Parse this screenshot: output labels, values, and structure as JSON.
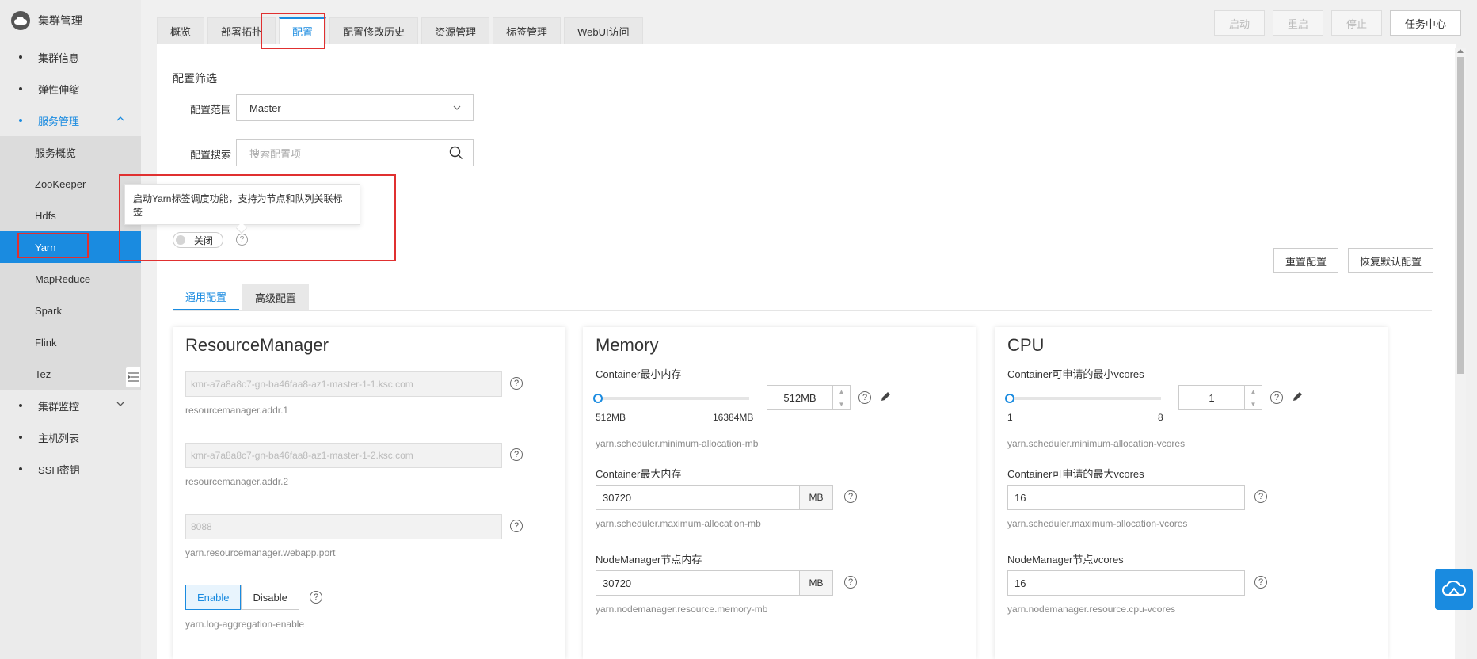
{
  "sidebar": {
    "title": "集群管理",
    "items": [
      {
        "label": "集群信息"
      },
      {
        "label": "弹性伸缩"
      },
      {
        "label": "服务管理"
      },
      {
        "label": "集群监控"
      },
      {
        "label": "主机列表"
      },
      {
        "label": "SSH密钥"
      }
    ],
    "sub_items": [
      {
        "label": "服务概览"
      },
      {
        "label": "ZooKeeper"
      },
      {
        "label": "Hdfs"
      },
      {
        "label": "Yarn"
      },
      {
        "label": "MapReduce"
      },
      {
        "label": "Spark"
      },
      {
        "label": "Flink"
      },
      {
        "label": "Tez"
      }
    ]
  },
  "tabs": [
    {
      "label": "概览"
    },
    {
      "label": "部署拓扑"
    },
    {
      "label": "配置"
    },
    {
      "label": "配置修改历史"
    },
    {
      "label": "资源管理"
    },
    {
      "label": "标签管理"
    },
    {
      "label": "WebUI访问"
    }
  ],
  "top_buttons": {
    "start": "启动",
    "restart": "重启",
    "stop": "停止",
    "task_center": "任务中心"
  },
  "filter": {
    "title": "配置筛选",
    "scope_label": "配置范围",
    "scope_value": "Master",
    "search_label": "配置搜索",
    "search_placeholder": "搜索配置项"
  },
  "tooltip": {
    "text": "启动Yarn标签调度功能，支持为节点和队列关联标签"
  },
  "switch": {
    "label": "关闭"
  },
  "actions": {
    "reset": "重置配置",
    "restore": "恢复默认配置"
  },
  "subtabs": [
    {
      "label": "通用配置"
    },
    {
      "label": "高级配置"
    }
  ],
  "cards": {
    "rm": {
      "title": "ResourceManager",
      "addr1_value": "kmr-a7a8a8c7-gn-ba46faa8-az1-master-1-1.ksc.com",
      "addr1_key": "resourcemanager.addr.1",
      "addr2_value": "kmr-a7a8a8c7-gn-ba46faa8-az1-master-1-2.ksc.com",
      "addr2_key": "resourcemanager.addr.2",
      "port_value": "8088",
      "port_key": "yarn.resourcemanager.webapp.port",
      "enable_label": "Enable",
      "disable_label": "Disable",
      "log_key": "yarn.log-aggregation-enable"
    },
    "memory": {
      "title": "Memory",
      "min_label": "Container最小内存",
      "min_value": "512MB",
      "slider_min": "512MB",
      "slider_max": "16384MB",
      "slider_level": 0,
      "min_key": "yarn.scheduler.minimum-allocation-mb",
      "max_label": "Container最大内存",
      "max_value": "30720",
      "max_unit": "MB",
      "max_key": "yarn.scheduler.maximum-allocation-mb",
      "nm_label": "NodeManager节点内存",
      "nm_value": "30720",
      "nm_unit": "MB",
      "nm_key": "yarn.nodemanager.resource.memory-mb"
    },
    "cpu": {
      "title": "CPU",
      "min_label": "Container可申请的最小vcores",
      "min_value": "1",
      "slider_min": "1",
      "slider_max": "8",
      "slider_level": 0,
      "min_key": "yarn.scheduler.minimum-allocation-vcores",
      "max_label": "Container可申请的最大vcores",
      "max_value": "16",
      "max_key": "yarn.scheduler.maximum-allocation-vcores",
      "nm_label": "NodeManager节点vcores",
      "nm_value": "16",
      "nm_key": "yarn.nodemanager.resource.cpu-vcores"
    }
  },
  "help_glyph": "?",
  "colors": {
    "accent": "#1a8be0",
    "highlight": "#e03030"
  }
}
